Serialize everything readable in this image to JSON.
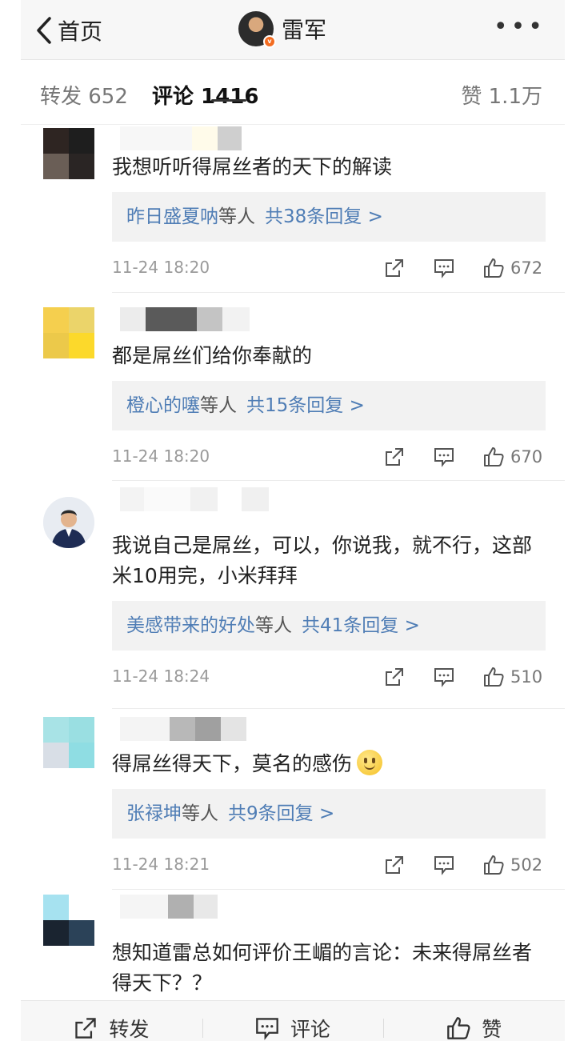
{
  "nav": {
    "back_label": "首页",
    "title": "雷军",
    "more": "•••"
  },
  "tabs": {
    "repost": "转发 652",
    "comment": "评论 1416",
    "like": "赞 1.1万"
  },
  "comments": [
    {
      "text": "我想听听得屌丝者的天下的解读",
      "reply_who": "昨日盛夏呐",
      "reply_etc": "等人",
      "reply_count": "共38条回复 >",
      "time": "11-24 18:20",
      "likes": "672"
    },
    {
      "text": "都是屌丝们给你奉献的",
      "reply_who": "橙心的噻",
      "reply_etc": "等人",
      "reply_count": "共15条回复 >",
      "time": "11-24 18:20",
      "likes": "670"
    },
    {
      "text": "我说自己是屌丝，可以，你说我，就不行，这部米10用完，小米拜拜",
      "reply_who": "美感带来的好处",
      "reply_etc": "等人",
      "reply_count": "共41条回复 >",
      "time": "11-24 18:24",
      "likes": "510"
    },
    {
      "text": "得屌丝得天下，莫名的感伤",
      "reply_who": "张禄坤",
      "reply_etc": "等人",
      "reply_count": "共9条回复 >",
      "time": "11-24 18:21",
      "likes": "502"
    },
    {
      "text": "想知道雷总如何评价王嵋的言论：未来得屌丝者得天下？？"
    }
  ],
  "bottom": {
    "repost": "转发",
    "comment": "评论",
    "like": "赞"
  },
  "colors": {
    "link": "#4f7db5",
    "time": "#9a9a9a",
    "reply_bg": "#f2f2f2",
    "verified": "#f36c21"
  }
}
